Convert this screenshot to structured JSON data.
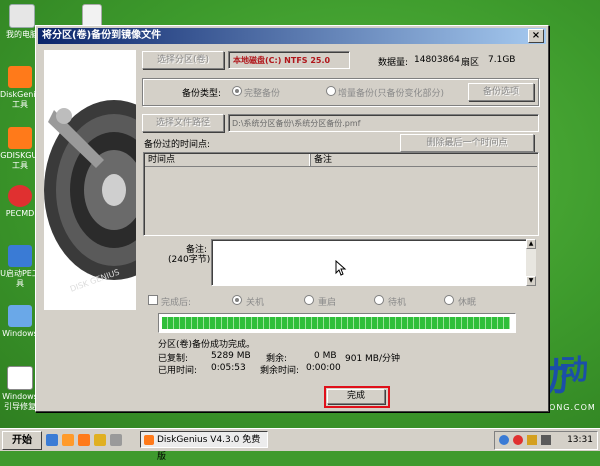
{
  "desktop": {
    "icons": [
      {
        "label": "我的电脑",
        "color": "#e6e6e6"
      },
      {
        "label": "",
        "color": "#f2f2f2"
      },
      {
        "label": "DiskGenius 工具",
        "color": "#ff7a1a"
      },
      {
        "label": "GDISKGUI 工具",
        "color": "#ff7a1a"
      },
      {
        "label": "PECMD",
        "color": "#e03030"
      },
      {
        "label": "U启动PE工具",
        "color": "#3a7bd5"
      },
      {
        "label": "Windows",
        "color": "#6aa8e8"
      },
      {
        "label": "Windows 引导修复",
        "color": "#ffffff"
      }
    ],
    "brand": {
      "mark": "U",
      "name": "启动",
      "site": "WWW.UQIDONG.COM",
      "top_chars": "动"
    }
  },
  "window": {
    "title": "将分区(卷)备份到镜像文件",
    "close_label": "×",
    "select_partition_label": "选择分区(卷)",
    "partition_value": "本地磁盘(C:) NTFS 25.0",
    "sector_count_label": "数据量:",
    "sector_count_value": "14803864",
    "sector_unit_label": "扇区",
    "size_value": "7.1GB",
    "backup_type_label": "备份类型:",
    "full_backup_label": "完整备份",
    "incremental_backup_label": "增量备份(只备份变化部分)",
    "backup_options_label": "备份选项",
    "select_file_label": "选择文件路径",
    "file_path_value": "D:\\系统分区备份\\系统分区备份.pmf",
    "backup_times_label": "备份过的时间点:",
    "delete_last_label": "删除最后一个时间点",
    "table_headers": [
      "时间点",
      "备注"
    ],
    "remark_label": "备注:",
    "remark_sub_label": "(240字节)",
    "after_done_label": "完成后:",
    "after_options": [
      "关机",
      "重启",
      "待机",
      "休眠"
    ],
    "progress_fraction": 1.0,
    "status_text": "分区(卷)备份成功完成。",
    "copied_label": "已复制:",
    "copied_value": "5289 MB",
    "remaining_label": "剩余:",
    "remaining_value": "0 MB",
    "speed_value": "901 MB/分钟",
    "elapsed_label": "已用时间:",
    "elapsed_value": "0:05:53",
    "remaining_time_label": "剩余时间:",
    "remaining_time_value": "0:00:00",
    "done_button_label": "完成"
  },
  "taskbar": {
    "start_label": "开始",
    "task_label": "DiskGenius V4.3.0 免费版",
    "clock": "13:31"
  }
}
